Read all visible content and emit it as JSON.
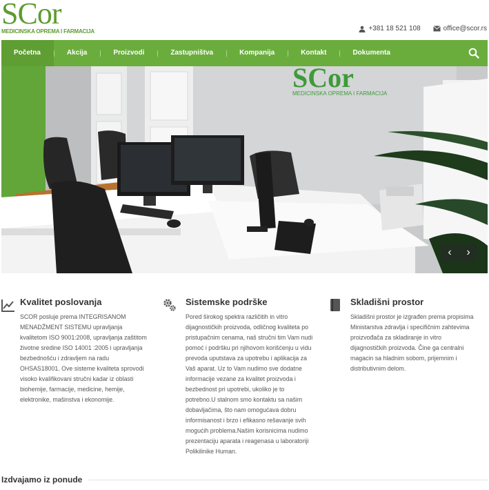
{
  "logo": {
    "mark": "SCor",
    "subtitle": "MEDICINSKA OPREMA I FARMACIJA"
  },
  "contacts": {
    "phone": "+381 18 521 108",
    "email": "office@scor.rs"
  },
  "nav": {
    "items": [
      {
        "label": "Početna",
        "active": true
      },
      {
        "label": "Akcija"
      },
      {
        "label": "Proizvodi"
      },
      {
        "label": "Zastupništva"
      },
      {
        "label": "Kompanija"
      },
      {
        "label": "Kontakt"
      },
      {
        "label": "Dokumenta"
      }
    ],
    "search_icon": "search-icon"
  },
  "hero": {
    "wall_logo": "SCor",
    "wall_logo_sub": "MEDICINSKA OPREMA I FARMACIJA",
    "prev": "‹",
    "next": "›"
  },
  "features": [
    {
      "icon": "chart-icon",
      "title": "Kvalitet poslovanja",
      "lines": [
        "SCOR posluje prema INTEGRISANOM",
        "MENADŽMENT SISTEMU upravljanja",
        "kvalitetom ISO 9001:2008, upravljanja zaštitom",
        "životne sredine ISO 14001 :2005 i upravljanja",
        "bezbednošću i zdravljem na radu",
        "OHSAS18001. Ove sisteme kvaliteta sprovodi",
        "visoko kvalifikovani stručni kadar iz oblasti",
        "biohemije, farmacije, medicine, hemije,",
        "elektronike, mašinstva i ekonomije."
      ]
    },
    {
      "icon": "gears-icon",
      "title": "Sistemske podrške",
      "lines": [
        "Pored širokog spektra različitih in vitro",
        "dijagnostičkih proizvoda, odličnog kvaliteta po",
        "pristupačnim cenama, naš stručni tim Vam nudi",
        "pomoć i podršku pri njihovom korišćenju u vidu",
        "prevoda uputstava za upotrebu i aplikacija za",
        "Vaš aparat. Uz to Vam nudimo sve dodatne",
        "informacije vezane za kvalitet proizvoda i",
        "bezbednost pri upotrebi, ukoliko je to",
        "potrebno.U stalnom smo kontaktu sa našim",
        "dobavljačima, što nam omogućava dobru",
        "informisanost i brzo i efikasno rešavanje svih",
        "mogućih problema.Našim korisnicima nudimo",
        "prezentaciju aparata i reagenasa u laboratoriji",
        "Polikilinike Human."
      ]
    },
    {
      "icon": "book-icon",
      "title": "Skladišni prostor",
      "lines": [
        "Skladišni prostor je izgrađen prema propisima",
        "Ministarstva zdravlja i specifičnim zahtevima",
        "proizvođača za skladiranje in vitro",
        "dijagnostičkih proizvoda. Čine ga centralni",
        "magacin sa hladnim sobom, prijemnim i",
        "distributivnim delom."
      ]
    }
  ],
  "section": {
    "title": "Izdvajamo iz ponude"
  },
  "colors": {
    "brand_green": "#6aad3d",
    "logo_green": "#5d9b2f"
  }
}
